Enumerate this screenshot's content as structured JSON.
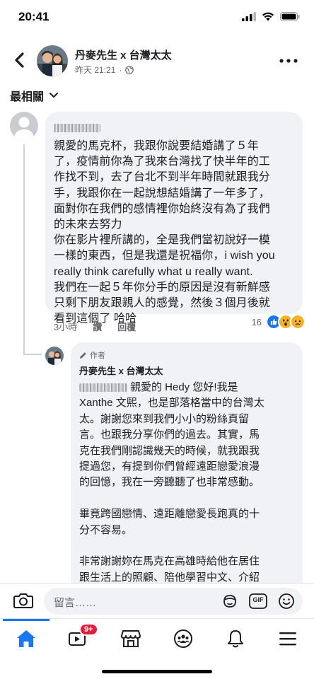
{
  "status_bar": {
    "time": "20:41"
  },
  "header": {
    "page_name": "丹麥先生 x 台灣太太",
    "timestamp": "昨天 21:21",
    "visibility_separator": "·"
  },
  "sort": {
    "label": "最相關"
  },
  "comment": {
    "text": "親愛的馬克杯，我跟你說要結婚講了５年\n了，疫情前你為了我來台灣找了快半年的工\n作找不到，去了台北不到半年時間就跟我分\n手，我跟你在一起說想結婚講了一年多了，\n面對你在我們的感情裡你始終沒有為了我們\n的未來去努力\n你在影片裡所講的，全是我們當初說好一模\n一樣的東西，但是我還是祝福你，i wish you\nreally think carefully what u really want.\n我們在一起５年你分手的原因是沒有新鮮感\n只剩下朋友跟親人的感覺，然後３個月後就\n看到這個了 哈哈",
    "time": "3小時",
    "like": "讚",
    "reply": "回覆",
    "reaction_count": "16"
  },
  "reply_comment": {
    "author_badge": "作者",
    "name": "丹麥先生 x 台灣太太",
    "text": "親愛的 Hedy 您好!我是\nXanthe 文熙，也是部落格當中的台灣太\n太。謝謝您來到我們小小的粉絲頁留\n言。也跟我分享你們的過去。其實，馬\n克在我們剛認識幾天的時候，就我跟我\n提過您，有提到你們曾經遠距戀愛浪漫\n的回憶，我在一旁聽聽了也非常感動。\n\n畢竟跨國戀情、遠距離戀愛長跑真的十\n分不容易。\n\n非常謝謝妳在馬克在高雄時給他在居住\n跟生活上的照顧、陪他學習中文、介紹\n台灣給他認識。"
  },
  "composer": {
    "placeholder": "留言……",
    "gif_label": "GIF"
  },
  "tabbar": {
    "video_badge": "9+"
  },
  "colors": {
    "accent": "#1877f2",
    "bubble": "#f0f2f5",
    "badge": "#e41e3f",
    "muted": "#65676b"
  }
}
